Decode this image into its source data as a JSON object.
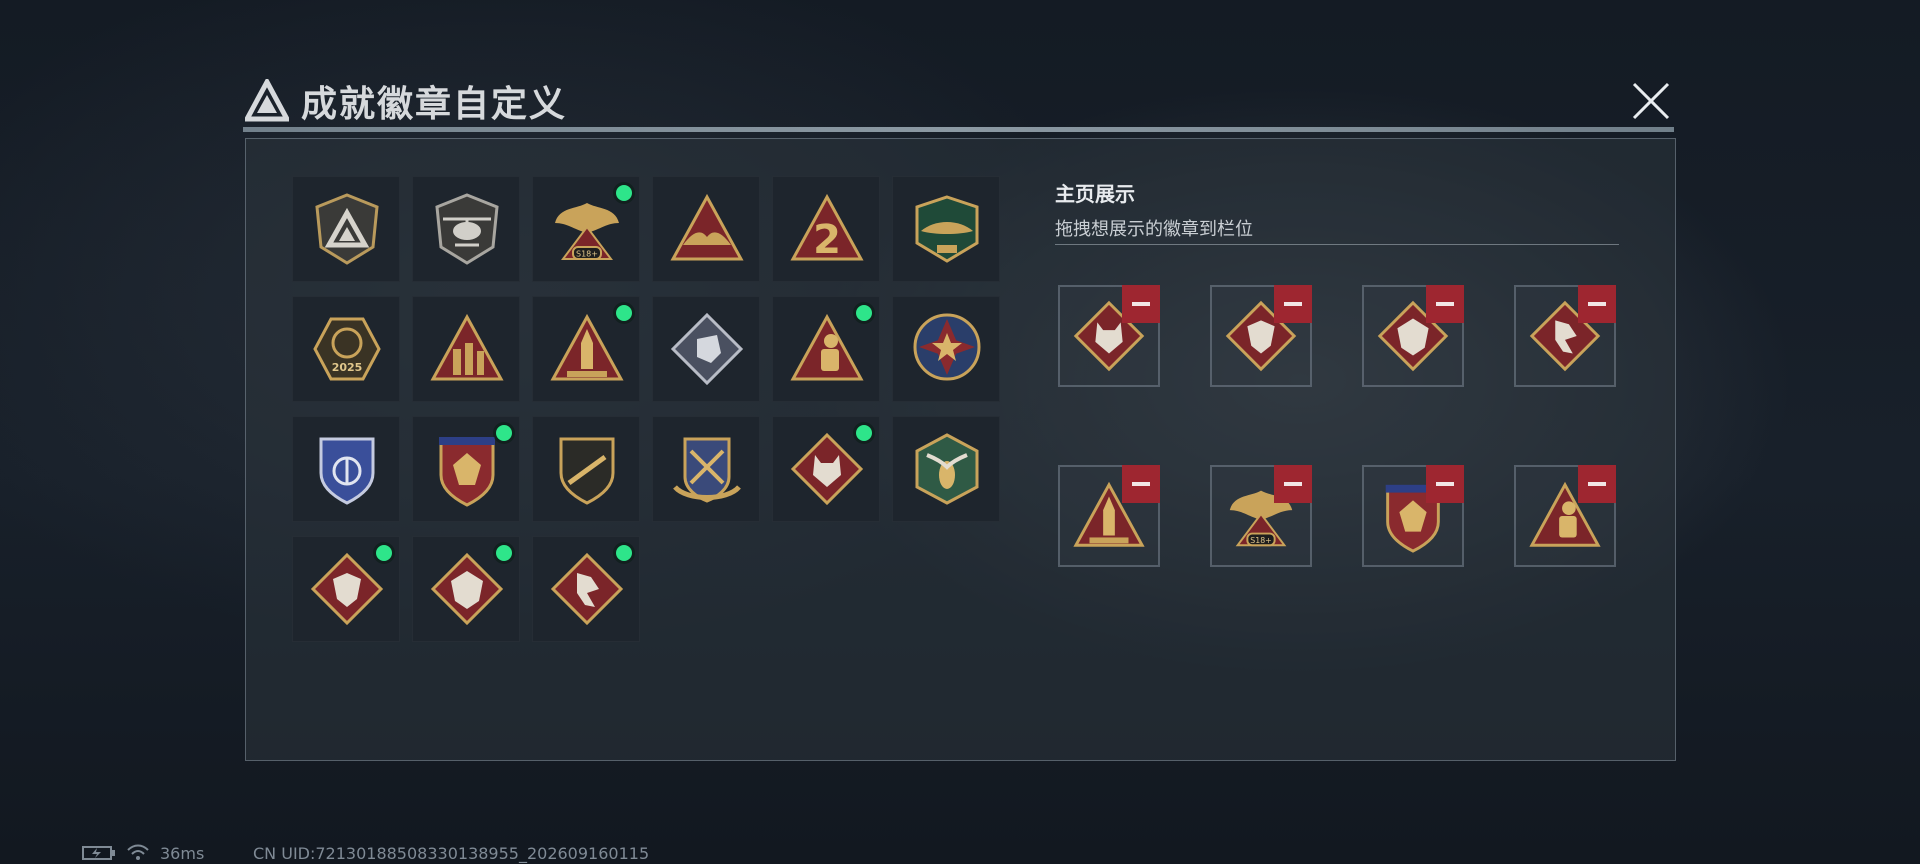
{
  "header": {
    "title": "成就徽章自定义",
    "logo_icon": "delta-triangle-icon",
    "close_icon": "close-x-icon"
  },
  "badge_grid": {
    "badges": [
      {
        "id": "b1",
        "icon": "shield-triangle-badge",
        "equipped": false
      },
      {
        "id": "b2",
        "icon": "helicopter-badge",
        "equipped": false
      },
      {
        "id": "b3",
        "icon": "eagle-s18-badge",
        "label": "S18+",
        "equipped": true
      },
      {
        "id": "b4",
        "icon": "triangle-wings-badge",
        "equipped": false
      },
      {
        "id": "b5",
        "icon": "triangle-2-badge",
        "label": "2",
        "equipped": false
      },
      {
        "id": "b6",
        "icon": "crocodile-delta-force-badge",
        "equipped": false
      },
      {
        "id": "b7",
        "icon": "delta-force-2025-badge",
        "label": "2025",
        "equipped": false
      },
      {
        "id": "b8",
        "icon": "soldiers-triangle-badge",
        "equipped": false
      },
      {
        "id": "b9",
        "icon": "rocket-triangle-badge",
        "equipped": true
      },
      {
        "id": "b10",
        "icon": "fist-diamond-badge",
        "equipped": false
      },
      {
        "id": "b11",
        "icon": "diver-triangle-badge",
        "equipped": true
      },
      {
        "id": "b12",
        "icon": "star-medallion-badge",
        "equipped": false
      },
      {
        "id": "b13",
        "icon": "blue-shield-badge",
        "equipped": false
      },
      {
        "id": "b14",
        "icon": "gem-shield-badge",
        "equipped": true
      },
      {
        "id": "b15",
        "icon": "rifle-shield-badge",
        "equipped": false
      },
      {
        "id": "b16",
        "icon": "crossed-arrows-badge",
        "equipped": false
      },
      {
        "id": "b17",
        "icon": "wolf-diamond-badge",
        "equipped": true
      },
      {
        "id": "b18",
        "icon": "wasp-hexagon-badge",
        "equipped": false
      },
      {
        "id": "b19",
        "icon": "dragon-diamond-badge",
        "equipped": true
      },
      {
        "id": "b20",
        "icon": "dragon-diamond-badge-2",
        "equipped": true
      },
      {
        "id": "b21",
        "icon": "runner-diamond-badge",
        "equipped": true
      }
    ]
  },
  "showcase": {
    "title": "主页展示",
    "subtitle": "拖拽想展示的徽章到栏位",
    "slots": [
      {
        "badge": "wolf-diamond-badge",
        "remove_icon": "minus-icon"
      },
      {
        "badge": "dragon-diamond-badge",
        "remove_icon": "minus-icon"
      },
      {
        "badge": "dragon-diamond-badge-2",
        "remove_icon": "minus-icon"
      },
      {
        "badge": "runner-diamond-badge",
        "remove_icon": "minus-icon"
      },
      {
        "badge": "rocket-triangle-badge",
        "remove_icon": "minus-icon"
      },
      {
        "badge": "eagle-s18-badge",
        "remove_icon": "minus-icon"
      },
      {
        "badge": "gem-shield-badge",
        "remove_icon": "minus-icon"
      },
      {
        "badge": "diver-triangle-badge",
        "remove_icon": "minus-icon"
      }
    ]
  },
  "status_bar": {
    "battery_icon": "battery-charging-icon",
    "wifi_icon": "wifi-icon",
    "ping": "36ms",
    "uid": "CN UID:7213018850833013895​5_202609160115"
  },
  "colors": {
    "accent_gold": "#c9a35a",
    "badge_red": "#8a2a2e",
    "equipped_dot": "#2ee58a",
    "remove_button": "#9e2630"
  }
}
